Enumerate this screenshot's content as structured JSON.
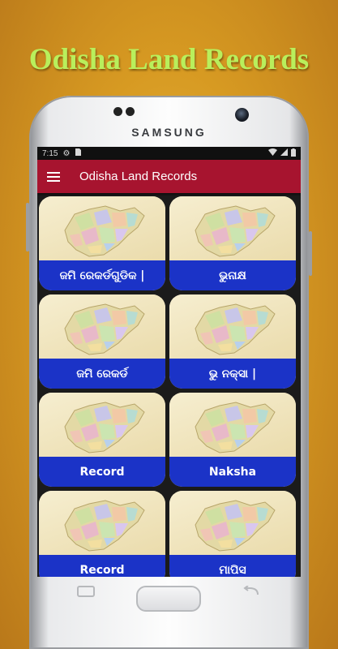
{
  "promo": {
    "title": "Odisha Land Records"
  },
  "device": {
    "brand": "SAMSUNG"
  },
  "statusbar": {
    "time": "7:15"
  },
  "appbar": {
    "title": "Odisha Land Records"
  },
  "tiles": [
    {
      "label": "ଜମି ରେକର୍ଡଗୁଡିକ |"
    },
    {
      "label": "ଭୁନାକ୍ଷ"
    },
    {
      "label": "ଜମି ରେକର୍ଡ"
    },
    {
      "label": "ଭୁ ନକ୍ସା |"
    },
    {
      "label": "Record"
    },
    {
      "label": "Naksha"
    },
    {
      "label": "Record"
    },
    {
      "label": "ମାପିସ"
    }
  ],
  "colors": {
    "appbar": "#a7142f",
    "tile_label_bar": "#1b33c7",
    "promo_title": "#b9ef5c"
  }
}
